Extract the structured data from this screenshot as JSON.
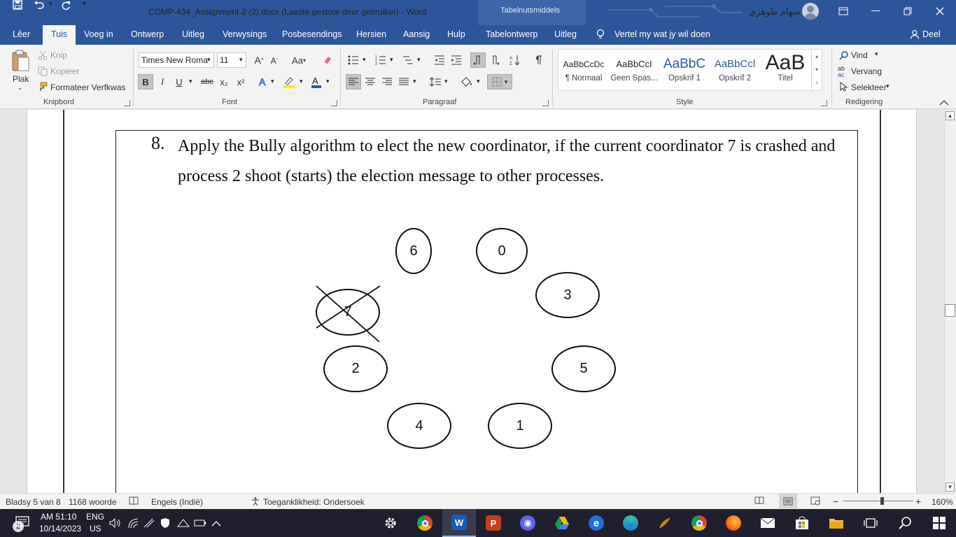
{
  "window": {
    "title": "COMP-434_Assignment-2 (2).docx (Laaste gestoor deur gebruiker)  -  Word",
    "context_label": "Tabelnutsmiddels",
    "user_name": "سهام طوهري"
  },
  "quick_access": {
    "save": "save-icon",
    "undo": "undo-icon",
    "redo": "redo-icon",
    "customize": "customize-icon"
  },
  "tabs": [
    "Lêer",
    "Tuis",
    "Voeg in",
    "Ontwerp",
    "Uitleg",
    "Verwysings",
    "Posbesendings",
    "Hersien",
    "Aansig",
    "Hulp",
    "Tabelontwerp",
    "Uitleg"
  ],
  "tell_me": "Vertel my wat jy wil doen",
  "share": "Deel",
  "clipboard": {
    "paste": "Plak",
    "cut": "Knip",
    "copy": "Kopieer",
    "format_painter": "Formateer Verfkwas",
    "label": "Knipbord"
  },
  "font": {
    "name": "Times New Roma",
    "size": "11",
    "label": "Font",
    "bold": "B",
    "italic": "I",
    "underline": "U",
    "strike": "abc",
    "subscript": "x₂",
    "superscript": "x²",
    "grow": "A",
    "shrink": "A",
    "case": "Aa"
  },
  "paragraph": {
    "label": "Paragraaf"
  },
  "styles": {
    "label": "Style",
    "items": [
      {
        "preview": "AaBbCcDc",
        "name": "¶ Normaal"
      },
      {
        "preview": "AaBbCcI",
        "name": "Geen Spas..."
      },
      {
        "preview": "AaBbC",
        "name": "Opskrif 1"
      },
      {
        "preview": "AaBbCcl",
        "name": "Opskrif 2"
      },
      {
        "preview": "AaB",
        "name": "Titel"
      }
    ]
  },
  "editing": {
    "label": "Redigering",
    "find": "Vind",
    "replace": "Vervang",
    "select": "Selekteer"
  },
  "document": {
    "question_number": "8.",
    "question_text": "Apply the Bully algorithm to elect the new coordinator, if the current coordinator 7 is crashed and process 2 shoot (starts) the election message to other processes.",
    "nodes": [
      "6",
      "0",
      "3",
      "7",
      "2",
      "5",
      "4",
      "1"
    ],
    "crashed_node": "7"
  },
  "status": {
    "page": "Bladsy 5 van 8",
    "words": "1168 woorde",
    "language": "Engels (Indië)",
    "accessibility": "Toeganklikheid: Ondersoek",
    "zoom": "160%"
  },
  "taskbar": {
    "time": "AM 51:10",
    "date": "10/14/2023",
    "lang_top": "ENG",
    "lang_bottom": "US",
    "badge": "2",
    "apps": [
      "settings-icon",
      "chrome-profile-icon",
      "word-icon",
      "powerpoint-icon",
      "discord-icon",
      "google-drive-icon",
      "edge-icon",
      "edge-new-icon",
      "paint-icon",
      "chrome-icon",
      "firefox-icon",
      "mail-icon",
      "store-icon",
      "file-explorer-icon",
      "taskview-icon",
      "search-icon",
      "start-icon"
    ]
  }
}
